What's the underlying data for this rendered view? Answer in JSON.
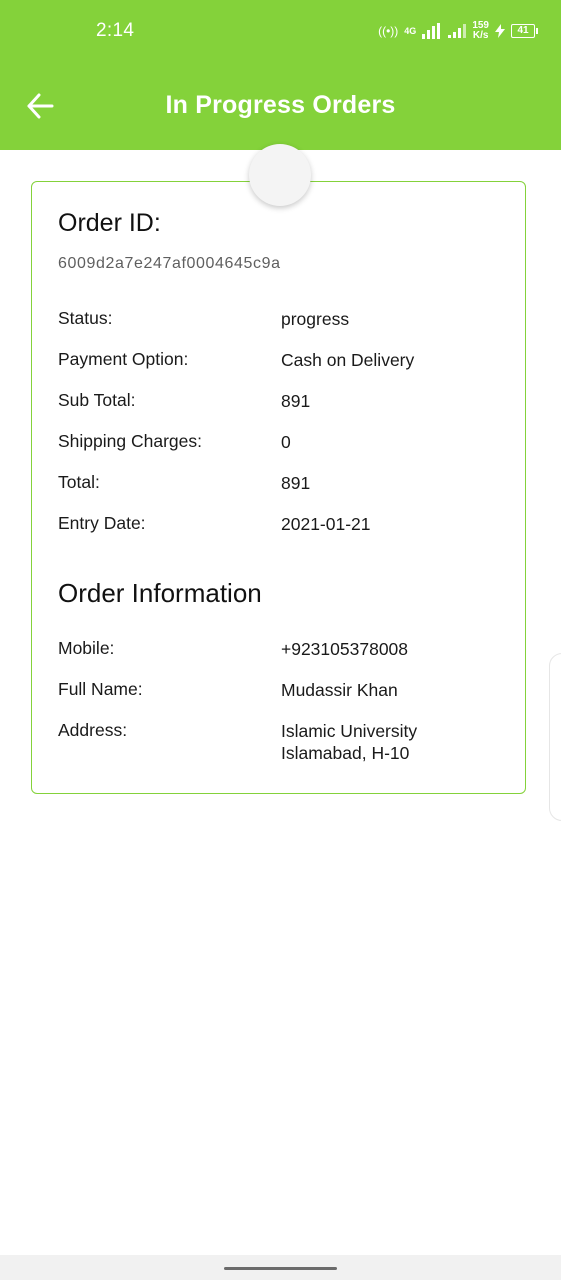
{
  "status_bar": {
    "time": "2:14",
    "network_type": "4G",
    "net_speed_value": "159",
    "net_speed_unit": "K/s",
    "battery_level": "41"
  },
  "header": {
    "title": "In Progress Orders",
    "back_icon": "arrow-left-icon",
    "background_color": "#84d23a"
  },
  "order": {
    "id_label": "Order ID:",
    "id_value": "6009d2a7e247af0004645c9a",
    "details": [
      {
        "label": "Status:",
        "value": "progress"
      },
      {
        "label": "Payment Option:",
        "value": "Cash on Delivery"
      },
      {
        "label": "Sub Total:",
        "value": "891"
      },
      {
        "label": "Shipping Charges:",
        "value": "0"
      },
      {
        "label": "Total:",
        "value": "891"
      },
      {
        "label": "Entry Date:",
        "value": "2021-01-21"
      }
    ],
    "info_title": "Order Information",
    "info": [
      {
        "label": "Mobile:",
        "value": "+923105378008"
      },
      {
        "label": "Full Name:",
        "value": "Mudassir Khan"
      },
      {
        "label": "Address:",
        "value": "Islamic University Islamabad, H-10"
      }
    ]
  },
  "colors": {
    "accent": "#84d23a",
    "card_border": "#84d23a"
  }
}
